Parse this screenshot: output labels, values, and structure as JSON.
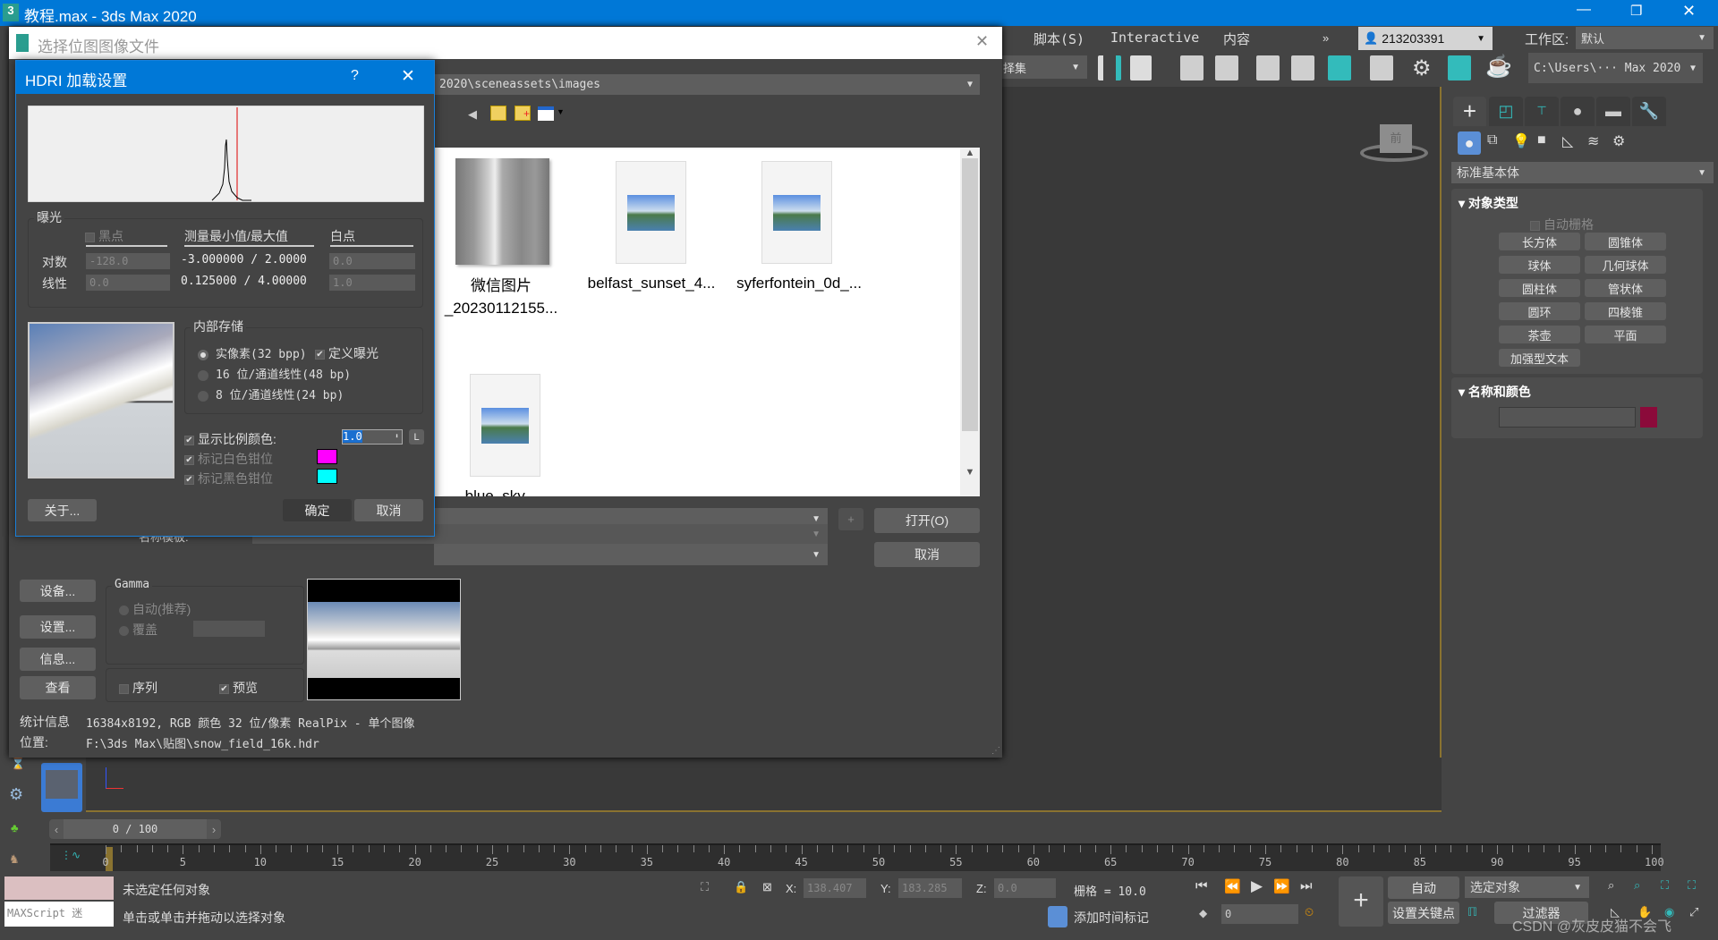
{
  "app": {
    "title": "教程.max - 3ds Max 2020",
    "logo": "3"
  },
  "menu": {
    "items": [
      "脚本(S)",
      "Interactive",
      "内容"
    ],
    "more": "»",
    "user": "213203391",
    "workspace_label": "工作区:",
    "workspace_value": "默认",
    "selection_set": "择集",
    "project_path": "C:\\Users\\··· Max 2020"
  },
  "file_dialog": {
    "title": "选择位图图像文件",
    "path": "2020\\sceneassets\\images",
    "files": [
      {
        "name1": "微信图片",
        "name2": "_20230112155..."
      },
      {
        "name1": "belfast_sunset_4..."
      },
      {
        "name1": "syferfontein_0d_..."
      },
      {
        "name1": "blue_sky_..."
      }
    ],
    "open_label": "打开(O)",
    "cancel_label": "取消",
    "plus_label": "+",
    "name_template_label": "名称模板:",
    "buttons": [
      "设备...",
      "设置...",
      "信息...",
      "查看"
    ],
    "gamma": {
      "title": "Gamma",
      "auto": "自动(推荐)",
      "override": "覆盖"
    },
    "sequence": "序列",
    "preview": "预览",
    "stats_label": "统计信息",
    "stats_value": "16384x8192, RGB 颜色 32 位/像素 RealPix - 单个图像",
    "location_label": "位置:",
    "location_value": "F:\\3ds Max\\贴图\\snow_field_16k.hdr"
  },
  "hdri": {
    "title": "HDRI 加载设置",
    "help": "?",
    "exposure": "曝光",
    "black_point": "黑点",
    "measure": "测量最小值/最大值",
    "white_point": "白点",
    "log_label": "对数",
    "linear_label": "线性",
    "log_black": "-128.0",
    "lin_black": "0.0",
    "log_measure": "-3.000000 / 2.0000",
    "lin_measure": "0.125000 / 4.00000",
    "log_white": "0.0",
    "lin_white": "1.0",
    "storage": "内部存储",
    "opt1": "实像素(32 bpp)",
    "opt2": "16 位/通道线性(48 bp)",
    "opt3": "8 位/通道线性(24 bp)",
    "def_exposure": "定义曝光",
    "show_scale": "显示比例颜色:",
    "scale_value": "1.0",
    "l_button": "L",
    "mark_white": "标记白色钳位",
    "mark_black": "标记黑色钳位",
    "white_color": "#ff00ff",
    "black_color": "#00ffff",
    "about": "关于...",
    "ok": "确定",
    "cancel": "取消"
  },
  "command_panel": {
    "category": "标准基本体",
    "rollout1": "对象类型",
    "autogrid": "自动栅格",
    "objects": [
      "长方体",
      "圆锥体",
      "球体",
      "几何球体",
      "圆柱体",
      "管状体",
      "圆环",
      "四棱锥",
      "茶壶",
      "平面",
      "加强型文本"
    ],
    "rollout2": "名称和颜色",
    "object_color": "#8b0a3a"
  },
  "viewcube_label": "前",
  "timeline": {
    "slider": "0 / 100",
    "ticks": [
      0,
      5,
      10,
      15,
      20,
      25,
      30,
      35,
      40,
      45,
      50,
      55,
      60,
      65,
      70,
      75,
      80,
      85,
      90,
      95,
      100
    ]
  },
  "status": {
    "line1": "未选定任何对象",
    "line2": "单击或单击并拖动以选择对象",
    "maxscript": "MAXScript 迷",
    "x_label": "X:",
    "x": "138.407",
    "y_label": "Y:",
    "y": "183.285",
    "z_label": "Z:",
    "z": "0.0",
    "grid": "栅格 = 10.0",
    "add_time_tag": "添加时间标记",
    "auto_key": "自动",
    "set_key": "设置关键点",
    "selected": "选定对象",
    "filters": "过滤器",
    "frame": "0",
    "watermark": "CSDN @灰皮皮猫不会飞"
  }
}
